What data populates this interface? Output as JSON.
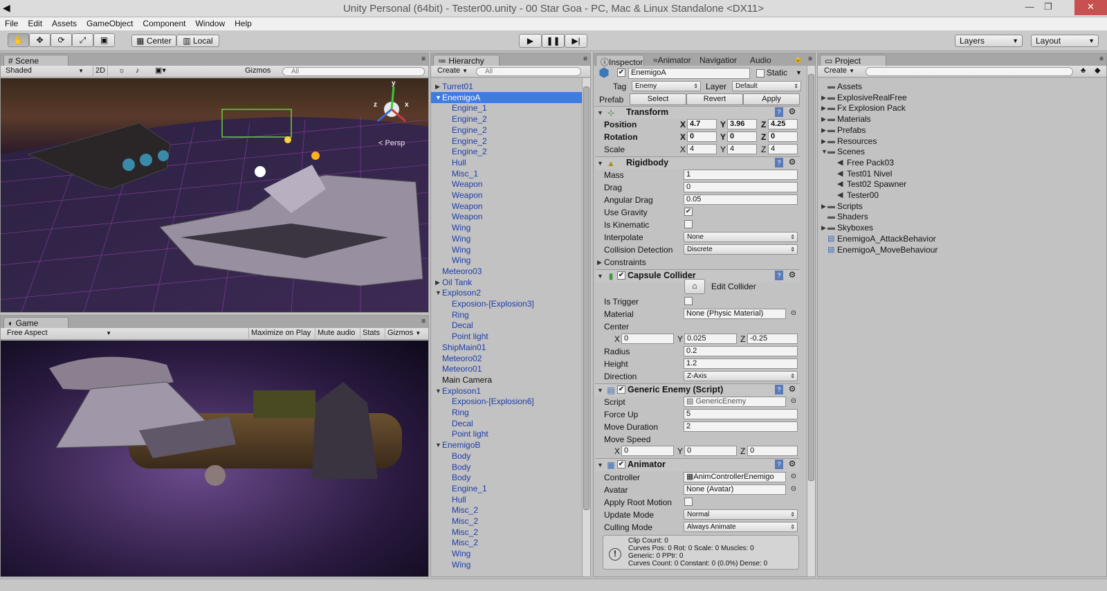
{
  "window": {
    "title": "Unity Personal (64bit) - Tester00.unity - 00 Star Goa - PC, Mac & Linux Standalone <DX11>"
  },
  "menu": [
    "File",
    "Edit",
    "Assets",
    "GameObject",
    "Component",
    "Window",
    "Help"
  ],
  "toolbar": {
    "center": "Center",
    "local": "Local",
    "layers": "Layers",
    "layout": "Layout"
  },
  "scene": {
    "tab": "Scene",
    "shading": "Shaded",
    "mode2d": "2D",
    "gizmos": "Gizmos",
    "search_placeholder": "All",
    "persp": "Persp",
    "axis_x": "x",
    "axis_y": "y",
    "axis_z": "z"
  },
  "game": {
    "tab": "Game",
    "aspect": "Free Aspect",
    "maximize": "Maximize on Play",
    "mute": "Mute audio",
    "stats": "Stats",
    "gizmos": "Gizmos"
  },
  "hierarchy": {
    "tab": "Hierarchy",
    "create": "Create",
    "search_placeholder": "All",
    "items": [
      {
        "label": "Turret01",
        "indent": 0,
        "prefab": true,
        "arrow": "right"
      },
      {
        "label": "EnemigoA",
        "indent": 0,
        "prefab": true,
        "arrow": "down",
        "selected": true
      },
      {
        "label": "Engine_1",
        "indent": 1,
        "prefab": true
      },
      {
        "label": "Engine_2",
        "indent": 1,
        "prefab": true
      },
      {
        "label": "Engine_2",
        "indent": 1,
        "prefab": true
      },
      {
        "label": "Engine_2",
        "indent": 1,
        "prefab": true
      },
      {
        "label": "Engine_2",
        "indent": 1,
        "prefab": true
      },
      {
        "label": "Hull",
        "indent": 1,
        "prefab": true
      },
      {
        "label": "Misc_1",
        "indent": 1,
        "prefab": true
      },
      {
        "label": "Weapon",
        "indent": 1,
        "prefab": true
      },
      {
        "label": "Weapon",
        "indent": 1,
        "prefab": true
      },
      {
        "label": "Weapon",
        "indent": 1,
        "prefab": true
      },
      {
        "label": "Weapon",
        "indent": 1,
        "prefab": true
      },
      {
        "label": "Wing",
        "indent": 1,
        "prefab": true
      },
      {
        "label": "Wing",
        "indent": 1,
        "prefab": true
      },
      {
        "label": "Wing",
        "indent": 1,
        "prefab": true
      },
      {
        "label": "Wing",
        "indent": 1,
        "prefab": true
      },
      {
        "label": "Meteoro03",
        "indent": 0,
        "prefab": true
      },
      {
        "label": "Oil Tank",
        "indent": 0,
        "prefab": true,
        "arrow": "right"
      },
      {
        "label": "Exploson2",
        "indent": 0,
        "prefab": true,
        "arrow": "down"
      },
      {
        "label": "Exposion-[Explosion3]",
        "indent": 1,
        "prefab": true
      },
      {
        "label": "Ring",
        "indent": 1,
        "prefab": true
      },
      {
        "label": "Decal",
        "indent": 1,
        "prefab": true
      },
      {
        "label": "Point light",
        "indent": 1,
        "prefab": true
      },
      {
        "label": "ShipMain01",
        "indent": 0,
        "prefab": true
      },
      {
        "label": "Meteoro02",
        "indent": 0,
        "prefab": true
      },
      {
        "label": "Meteoro01",
        "indent": 0,
        "prefab": true
      },
      {
        "label": "Main Camera",
        "indent": 0,
        "prefab": false
      },
      {
        "label": "Exploson1",
        "indent": 0,
        "prefab": true,
        "arrow": "down"
      },
      {
        "label": "Exposion-[Explosion6]",
        "indent": 1,
        "prefab": true
      },
      {
        "label": "Ring",
        "indent": 1,
        "prefab": true
      },
      {
        "label": "Decal",
        "indent": 1,
        "prefab": true
      },
      {
        "label": "Point light",
        "indent": 1,
        "prefab": true
      },
      {
        "label": "EnemigoB",
        "indent": 0,
        "prefab": true,
        "arrow": "down"
      },
      {
        "label": "Body",
        "indent": 1,
        "prefab": true
      },
      {
        "label": "Body",
        "indent": 1,
        "prefab": true
      },
      {
        "label": "Body",
        "indent": 1,
        "prefab": true
      },
      {
        "label": "Engine_1",
        "indent": 1,
        "prefab": true
      },
      {
        "label": "Hull",
        "indent": 1,
        "prefab": true
      },
      {
        "label": "Misc_2",
        "indent": 1,
        "prefab": true
      },
      {
        "label": "Misc_2",
        "indent": 1,
        "prefab": true
      },
      {
        "label": "Misc_2",
        "indent": 1,
        "prefab": true
      },
      {
        "label": "Misc_2",
        "indent": 1,
        "prefab": true
      },
      {
        "label": "Wing",
        "indent": 1,
        "prefab": true
      },
      {
        "label": "Wing",
        "indent": 1,
        "prefab": true
      }
    ]
  },
  "inspector": {
    "tabs": [
      "Inspector",
      "Animator",
      "Navigatior",
      "Audio Mix"
    ],
    "object_name": "EnemigoA",
    "static_label": "Static",
    "tag_label": "Tag",
    "tag_value": "Enemy",
    "layer_label": "Layer",
    "layer_value": "Default",
    "prefab_label": "Prefab",
    "select": "Select",
    "revert": "Revert",
    "apply": "Apply",
    "transform": {
      "title": "Transform",
      "position": "Position",
      "rotation": "Rotation",
      "scale": "Scale",
      "pos": [
        "4.7",
        "3.96",
        "4.25"
      ],
      "rot": [
        "0",
        "0",
        "0"
      ],
      "scl": [
        "4",
        "4",
        "4"
      ],
      "x": "X",
      "y": "Y",
      "z": "Z"
    },
    "rigidbody": {
      "title": "Rigidbody",
      "mass_l": "Mass",
      "mass": "1",
      "drag_l": "Drag",
      "drag": "0",
      "adrag_l": "Angular Drag",
      "adrag": "0.05",
      "grav_l": "Use Gravity",
      "kin_l": "Is Kinematic",
      "interp_l": "Interpolate",
      "interp": "None",
      "coll_l": "Collision Detection",
      "coll": "Discrete",
      "constraints": "Constraints"
    },
    "capsule": {
      "title": "Capsule Collider",
      "edit": "Edit Collider",
      "trigger_l": "Is Trigger",
      "material_l": "Material",
      "material": "None (Physic Material)",
      "center_l": "Center",
      "center": [
        "0",
        "0.025",
        "-0.25"
      ],
      "radius_l": "Radius",
      "radius": "0.2",
      "height_l": "Height",
      "height": "1.2",
      "dir_l": "Direction",
      "dir": "Z-Axis"
    },
    "generic": {
      "title": "Generic Enemy (Script)",
      "script_l": "Script",
      "script": "GenericEnemy",
      "force_l": "Force Up",
      "force": "5",
      "dur_l": "Move Duration",
      "dur": "2",
      "speed_l": "Move Speed",
      "speed": [
        "0",
        "0",
        "0"
      ]
    },
    "animator": {
      "title": "Animator",
      "ctrl_l": "Controller",
      "ctrl": "AnimControllerEnemigo",
      "avatar_l": "Avatar",
      "avatar": "None (Avatar)",
      "root_l": "Apply Root Motion",
      "upd_l": "Update Mode",
      "upd": "Normal",
      "cull_l": "Culling Mode",
      "cull": "Always Animate",
      "info": [
        "Clip Count: 0",
        "Curves Pos: 0 Rot: 0 Scale: 0 Muscles: 0",
        "Generic: 0 PPtr: 0",
        "Curves Count: 0 Constant: 0 (0.0%) Dense: 0"
      ]
    }
  },
  "project": {
    "tab": "Project",
    "create": "Create",
    "items": [
      {
        "label": "Assets",
        "type": "folder"
      },
      {
        "label": "ExplosiveRealFree",
        "type": "folder",
        "arrow": "right"
      },
      {
        "label": "Fx Explosion Pack",
        "type": "folder",
        "arrow": "right"
      },
      {
        "label": "Materials",
        "type": "folder",
        "arrow": "right"
      },
      {
        "label": "Prefabs",
        "type": "folder",
        "arrow": "right"
      },
      {
        "label": "Resources",
        "type": "folder",
        "arrow": "right"
      },
      {
        "label": "Scenes",
        "type": "folder",
        "arrow": "down"
      },
      {
        "label": "Free Pack03",
        "type": "scene",
        "indent": 1
      },
      {
        "label": "Test01 Nivel",
        "type": "scene",
        "indent": 1
      },
      {
        "label": "Test02 Spawner",
        "type": "scene",
        "indent": 1
      },
      {
        "label": "Tester00",
        "type": "scene",
        "indent": 1
      },
      {
        "label": "Scripts",
        "type": "folder",
        "arrow": "right"
      },
      {
        "label": "Shaders",
        "type": "folder"
      },
      {
        "label": "Skyboxes",
        "type": "folder",
        "arrow": "right"
      },
      {
        "label": "EnemigoA_AttackBehavior",
        "type": "script"
      },
      {
        "label": "EnemigoA_MoveBehaviour",
        "type": "script"
      }
    ]
  }
}
